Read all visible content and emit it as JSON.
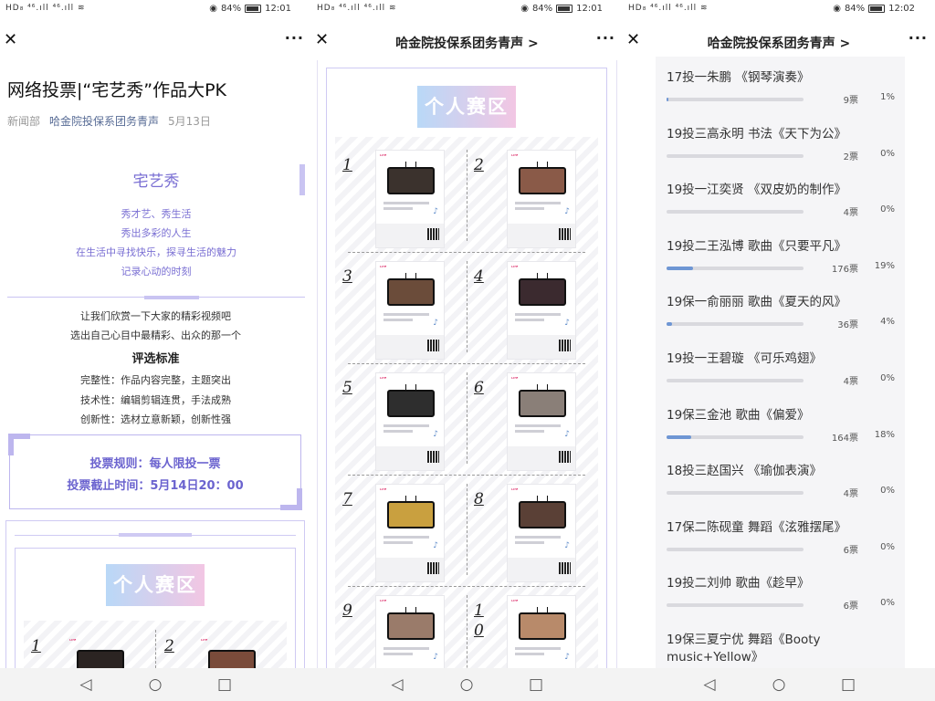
{
  "status": {
    "left": "HD₈ ⁴⁶.ıll ⁴⁶.ıll ≋",
    "battery_pct": "84%",
    "panels_time": [
      "12:01",
      "12:01",
      "12:02"
    ]
  },
  "panel1": {
    "article_title": "网络投票|“宅艺秀”作品大PK",
    "meta": {
      "dept": "新闻部",
      "account": "哈金院投保系团务青声",
      "date": "5月13日"
    },
    "intro_title": "宅艺秀",
    "intro_lines": [
      "秀才艺、秀生活",
      "秀出多彩的人生",
      "在生活中寻找快乐，探寻生活的魅力",
      "记录心动的时刻"
    ],
    "body_lines": [
      "让我们欣赏一下大家的精彩视频吧",
      "选出自己心目中最精彩、出众的那一个"
    ],
    "standard_title": "评选标准",
    "standards": [
      "完整性：作品内容完整，主题突出",
      "技术性：编辑剪辑连贯，手法成熟",
      "创新性：选材立意新颖，创新性强"
    ],
    "rules": [
      "投票规则：每人限投一票",
      "投票截止时间：5月14日20：00"
    ],
    "zone_title": "个人赛区",
    "cells": [
      "1",
      "2"
    ]
  },
  "panel2": {
    "nav_title": "哈金院投保系团务青声 >",
    "zone_title": "个人赛区",
    "cells": [
      "1",
      "2",
      "3",
      "4",
      "5",
      "6",
      "7",
      "8",
      "9",
      "1\n0"
    ]
  },
  "panel3": {
    "nav_title": "哈金院投保系团务青声 >",
    "votes": [
      {
        "name": "17投一朱鹏 《钢琴演奏》",
        "count": "9票",
        "pct": "1%",
        "fraction": 0.01
      },
      {
        "name": "19投三高永明 书法《天下为公》",
        "count": "2票",
        "pct": "0%",
        "fraction": 0.0
      },
      {
        "name": "19投一江奕贤 《双皮奶的制作》",
        "count": "4票",
        "pct": "0%",
        "fraction": 0.0
      },
      {
        "name": "19投二王泓博 歌曲《只要平凡》",
        "count": "176票",
        "pct": "19%",
        "fraction": 0.19
      },
      {
        "name": "19保一俞丽丽 歌曲《夏天的风》",
        "count": "36票",
        "pct": "4%",
        "fraction": 0.04
      },
      {
        "name": "19投一王碧璇 《可乐鸡翅》",
        "count": "4票",
        "pct": "0%",
        "fraction": 0.0
      },
      {
        "name": "19保三金池 歌曲《偏爱》",
        "count": "164票",
        "pct": "18%",
        "fraction": 0.18
      },
      {
        "name": "18投三赵国兴 《瑜伽表演》",
        "count": "4票",
        "pct": "0%",
        "fraction": 0.0
      },
      {
        "name": "17保二陈砚童 舞蹈《泫雅摆尾》",
        "count": "6票",
        "pct": "0%",
        "fraction": 0.0
      },
      {
        "name": "19投二刘帅 歌曲《趁早》",
        "count": "6票",
        "pct": "0%",
        "fraction": 0.0
      },
      {
        "name": "19保三夏宁优 舞蹈《Booty music+Yellow》",
        "count": "",
        "pct": "",
        "fraction": 0.0
      }
    ]
  },
  "icons": {
    "close": "close-icon",
    "more": "more-icon",
    "back": "back-triangle-icon",
    "home": "home-circle-icon",
    "recent": "recent-square-icon"
  },
  "system_nav": {
    "back": "◁",
    "home": "○",
    "recent": "□"
  },
  "accent": "#6b63cf",
  "bar_color": "#6e96d4"
}
